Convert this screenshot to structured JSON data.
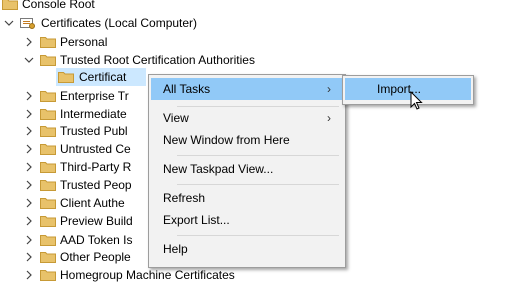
{
  "tree": {
    "items": [
      {
        "label": "Console Root",
        "expanded": true
      },
      {
        "label": "Certificates (Local Computer)",
        "expanded": true
      },
      {
        "label": "Personal",
        "expanded": false
      },
      {
        "label": "Trusted Root Certification Authorities",
        "expanded": true
      },
      {
        "label": "Certificat",
        "selected": true
      },
      {
        "label": "Enterprise Tr",
        "expanded": false
      },
      {
        "label": "Intermediate",
        "expanded": false
      },
      {
        "label": "Trusted Publ",
        "expanded": false
      },
      {
        "label": "Untrusted Ce",
        "expanded": false
      },
      {
        "label": "Third-Party R",
        "expanded": false
      },
      {
        "label": "Trusted Peop",
        "expanded": false
      },
      {
        "label": "Client Authe",
        "expanded": false
      },
      {
        "label": "Preview Build",
        "expanded": false
      },
      {
        "label": "AAD Token Is",
        "expanded": false
      },
      {
        "label": "Other People",
        "expanded": false
      },
      {
        "label": "Homegroup Machine Certificates",
        "expanded": false
      }
    ]
  },
  "context_menu": {
    "all_tasks": "All Tasks",
    "view": "View",
    "new_window": "New Window from Here",
    "new_taskpad": "New Taskpad View...",
    "refresh": "Refresh",
    "export_list": "Export List...",
    "help": "Help",
    "submenu_arrow": "›"
  },
  "submenu": {
    "import": "Import..."
  },
  "colors": {
    "selection": "#cce8ff",
    "menu_highlight": "#91c9f7",
    "folder": "#e8c26a"
  },
  "icons": {
    "folder": "folder-icon",
    "chevron_right": "chevron-right-icon",
    "chevron_down": "chevron-down-icon",
    "certificates_snapin": "certificate-snapin-icon",
    "cursor": "mouse-pointer-icon"
  }
}
